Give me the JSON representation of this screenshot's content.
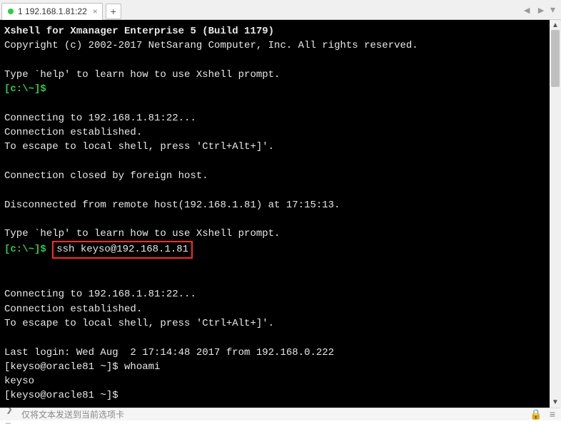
{
  "tab": {
    "index": "1",
    "title": "192.168.1.81:22",
    "close": "×",
    "add": "+"
  },
  "nav": {
    "left": "◄",
    "right": "►",
    "down": "▾"
  },
  "term": {
    "l01": "Xshell for Xmanager Enterprise 5 (Build 1179)",
    "l02": "Copyright (c) 2002-2017 NetSarang Computer, Inc. All rights reserved.",
    "l03": "",
    "l04": "Type `help' to learn how to use Xshell prompt.",
    "l05_prompt": "[c:\\~]$",
    "l06": "",
    "l07": "Connecting to 192.168.1.81:22...",
    "l08": "Connection established.",
    "l09": "To escape to local shell, press 'Ctrl+Alt+]'.",
    "l10": "",
    "l11": "Connection closed by foreign host.",
    "l12": "",
    "l13": "Disconnected from remote host(192.168.1.81) at 17:15:13.",
    "l14": "",
    "l15": "Type `help' to learn how to use Xshell prompt.",
    "l16_prompt": "[c:\\~]$",
    "l16_cmd": "ssh keyso@192.168.1.81",
    "l17": "",
    "l18": "",
    "l19": "Connecting to 192.168.1.81:22...",
    "l20": "Connection established.",
    "l21": "To escape to local shell, press 'Ctrl+Alt+]'.",
    "l22": "",
    "l23": "Last login: Wed Aug  2 17:14:48 2017 from 192.168.0.222",
    "l24_prompt": "[keyso@oracle81 ~]$ ",
    "l24_cmd": "whoami",
    "l25": "keyso",
    "l26_prompt": "[keyso@oracle81 ~]$ "
  },
  "status": {
    "text": "仅将文本发送到当前选项卡"
  },
  "scroll": {
    "up": "▲",
    "down": "▼"
  },
  "icons": {
    "terminal": "❯_",
    "lock": "🔒",
    "menu": "≡"
  }
}
